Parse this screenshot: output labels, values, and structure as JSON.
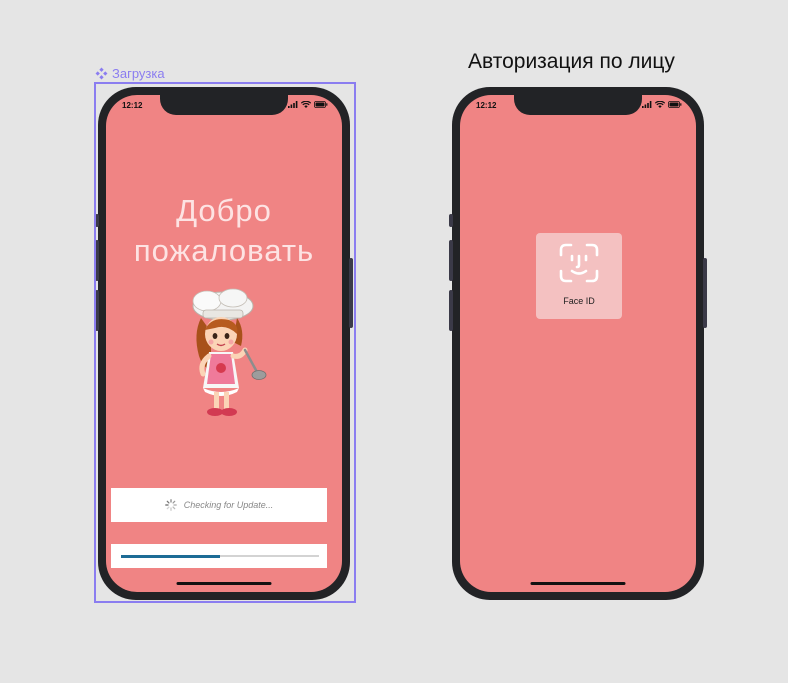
{
  "frame1": {
    "label": "Загрузка",
    "status_time": "12:12",
    "welcome_line1": "Добро",
    "welcome_line2": "пожаловать",
    "update_text": "Checking for Update...",
    "progress": 0.5
  },
  "frame2": {
    "title": "Авторизация по лицу",
    "status_time": "12:12",
    "faceid_label": "Face ID"
  },
  "colors": {
    "screen_bg": "#f08484",
    "selection": "#8b7df0",
    "progress": "#1d6c96"
  },
  "icons": [
    "component-icon",
    "signal-icon",
    "wifi-icon",
    "battery-icon",
    "spinner-icon",
    "face-id-icon",
    "chef-girl-illustration"
  ]
}
